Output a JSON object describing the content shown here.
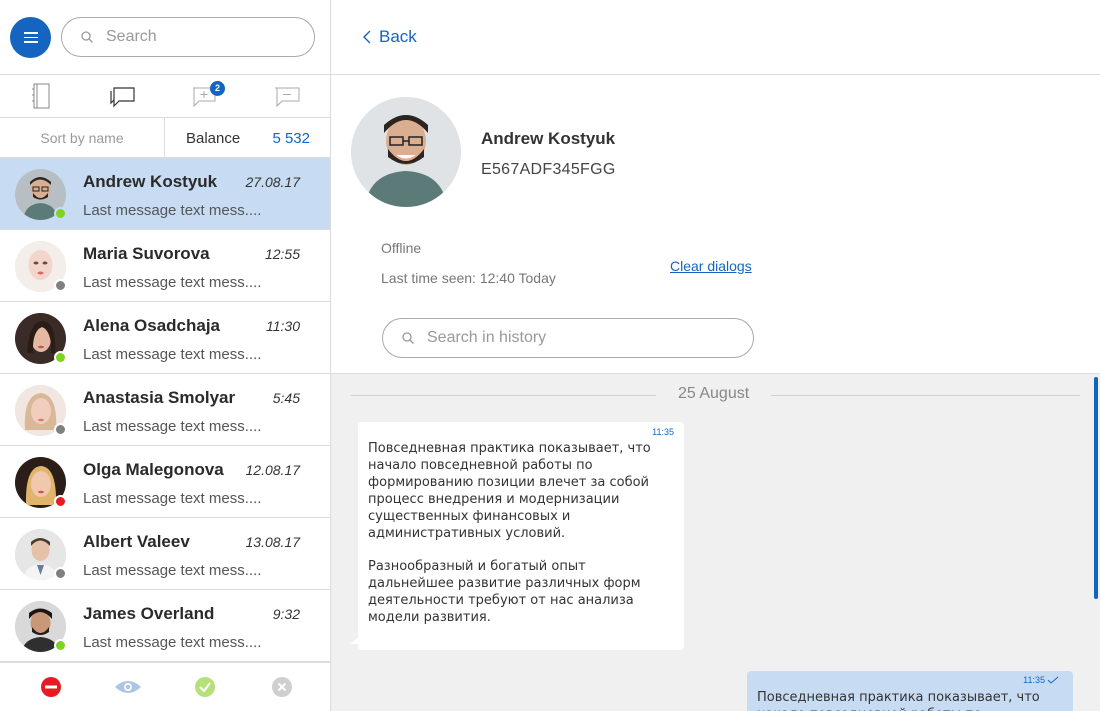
{
  "sidebar": {
    "search_placeholder": "Search",
    "tabs": [
      {
        "name": "contacts-book"
      },
      {
        "name": "chats"
      },
      {
        "name": "new-chats",
        "badge": "2"
      },
      {
        "name": "archived-chats"
      }
    ],
    "sort_label": "Sort by name",
    "balance_label": "Balance",
    "balance_value": "5 532",
    "contacts": [
      {
        "name": "Andrew Kostyuk",
        "time": "27.08.17",
        "message": "Last message text mess....",
        "status_color": "#7ed321"
      },
      {
        "name": "Maria Suvorova",
        "time": "12:55",
        "message": "Last message text mess....",
        "status_color": "#808080"
      },
      {
        "name": "Alena Osadchaja",
        "time": "11:30",
        "message": "Last message text mess....",
        "status_color": "#7ed321"
      },
      {
        "name": "Anastasia Smolyar",
        "time": "5:45",
        "message": "Last message text mess....",
        "status_color": "#808080"
      },
      {
        "name": "Olga Malegonova",
        "time": "12.08.17",
        "message": "Last message text mess....",
        "status_color": "#e51c23"
      },
      {
        "name": "Albert Valeev",
        "time": "13.08.17",
        "message": "Last message text mess....",
        "status_color": "#808080"
      },
      {
        "name": "James Overland",
        "time": "9:32",
        "message": "Last message text mess....",
        "status_color": "#7ed321"
      }
    ]
  },
  "header": {
    "back_label": "Back"
  },
  "profile": {
    "name": "Andrew Kostyuk",
    "id": "E567ADF345FGG",
    "status": "Offline",
    "last_seen": "Last time seen: 12:40 Today",
    "clear_label": "Clear dialogs",
    "history_placeholder": "Search in history"
  },
  "chat": {
    "date": "25 August",
    "incoming": {
      "time": "11:35",
      "paragraph1": "Повседневная практика показывает, что начало повседневной работы по формированию позиции влечет за собой процесс внедрения и модернизации существенных финансовых и административных условий.",
      "paragraph2": "Разнообразный и богатый опыт дальнейшее развитие различных форм деятельности требуют от нас анализа модели развития."
    },
    "outgoing": {
      "time": "11:35",
      "text": "Повседневная практика показывает, что начало повседневной работы по"
    }
  },
  "colors": {
    "accent": "#1565c0",
    "active_row": "#c7dcf3",
    "online": "#7ed321",
    "offline": "#808080",
    "busy": "#e51c23"
  }
}
